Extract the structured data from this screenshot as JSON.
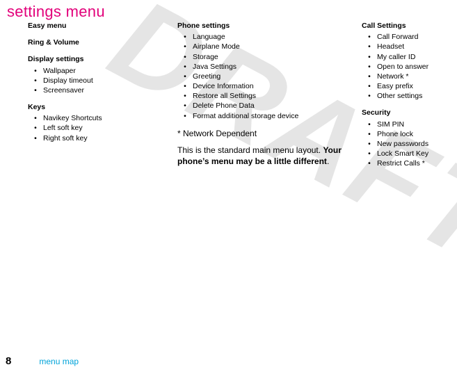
{
  "watermark": "DRAFT",
  "title": "settings menu",
  "bullet": "•",
  "col1": {
    "groups": [
      {
        "heading": "Easy menu",
        "items": []
      },
      {
        "heading": "Ring & Volume",
        "items": []
      },
      {
        "heading": "Display settings",
        "items": [
          "Wallpaper",
          "Display timeout",
          "Screensaver"
        ]
      },
      {
        "heading": "Keys",
        "items": [
          "Navikey Shortcuts",
          "Left soft key",
          "Right soft key"
        ]
      }
    ]
  },
  "col2": {
    "groups": [
      {
        "heading": "Phone settings",
        "items": [
          "Language",
          "Airplane Mode",
          "Storage",
          "Java Settings",
          "Greeting",
          "Device Information",
          "Restore all Settings",
          "Delete Phone Data",
          "Format additional storage device"
        ]
      }
    ],
    "note1": "* Network Dependent",
    "note2": "This is the standard main menu layout. ",
    "note3": "Your phone’s menu may be a little different",
    "note4": "."
  },
  "col3": {
    "groups": [
      {
        "heading": "Call Settings",
        "items": [
          "Call Forward",
          "Headset",
          "My caller ID",
          "Open to answer",
          "Network *",
          "Easy prefix",
          "Other settings"
        ]
      },
      {
        "heading": "Security",
        "items": [
          "SIM PIN",
          "Phone lock",
          "New passwords",
          "Lock Smart Key",
          "Restrict Calls *"
        ]
      }
    ]
  },
  "footer": {
    "pageNum": "8",
    "section": "menu map"
  },
  "chart_data": {
    "type": "table",
    "title": "settings menu",
    "columns": [
      {
        "sections": [
          {
            "name": "Easy menu",
            "items": []
          },
          {
            "name": "Ring & Volume",
            "items": []
          },
          {
            "name": "Display settings",
            "items": [
              "Wallpaper",
              "Display timeout",
              "Screensaver"
            ]
          },
          {
            "name": "Keys",
            "items": [
              "Navikey Shortcuts",
              "Left soft key",
              "Right soft key"
            ]
          }
        ]
      },
      {
        "sections": [
          {
            "name": "Phone settings",
            "items": [
              "Language",
              "Airplane Mode",
              "Storage",
              "Java Settings",
              "Greeting",
              "Device Information",
              "Restore all Settings",
              "Delete Phone Data",
              "Format additional storage device"
            ]
          }
        ],
        "notes": [
          "* Network Dependent",
          "This is the standard main menu layout. Your phone’s menu may be a little different."
        ]
      },
      {
        "sections": [
          {
            "name": "Call Settings",
            "items": [
              "Call Forward",
              "Headset",
              "My caller ID",
              "Open to answer",
              "Network *",
              "Easy prefix",
              "Other settings"
            ]
          },
          {
            "name": "Security",
            "items": [
              "SIM PIN",
              "Phone lock",
              "New passwords",
              "Lock Smart Key",
              "Restrict Calls *"
            ]
          }
        ]
      }
    ]
  }
}
